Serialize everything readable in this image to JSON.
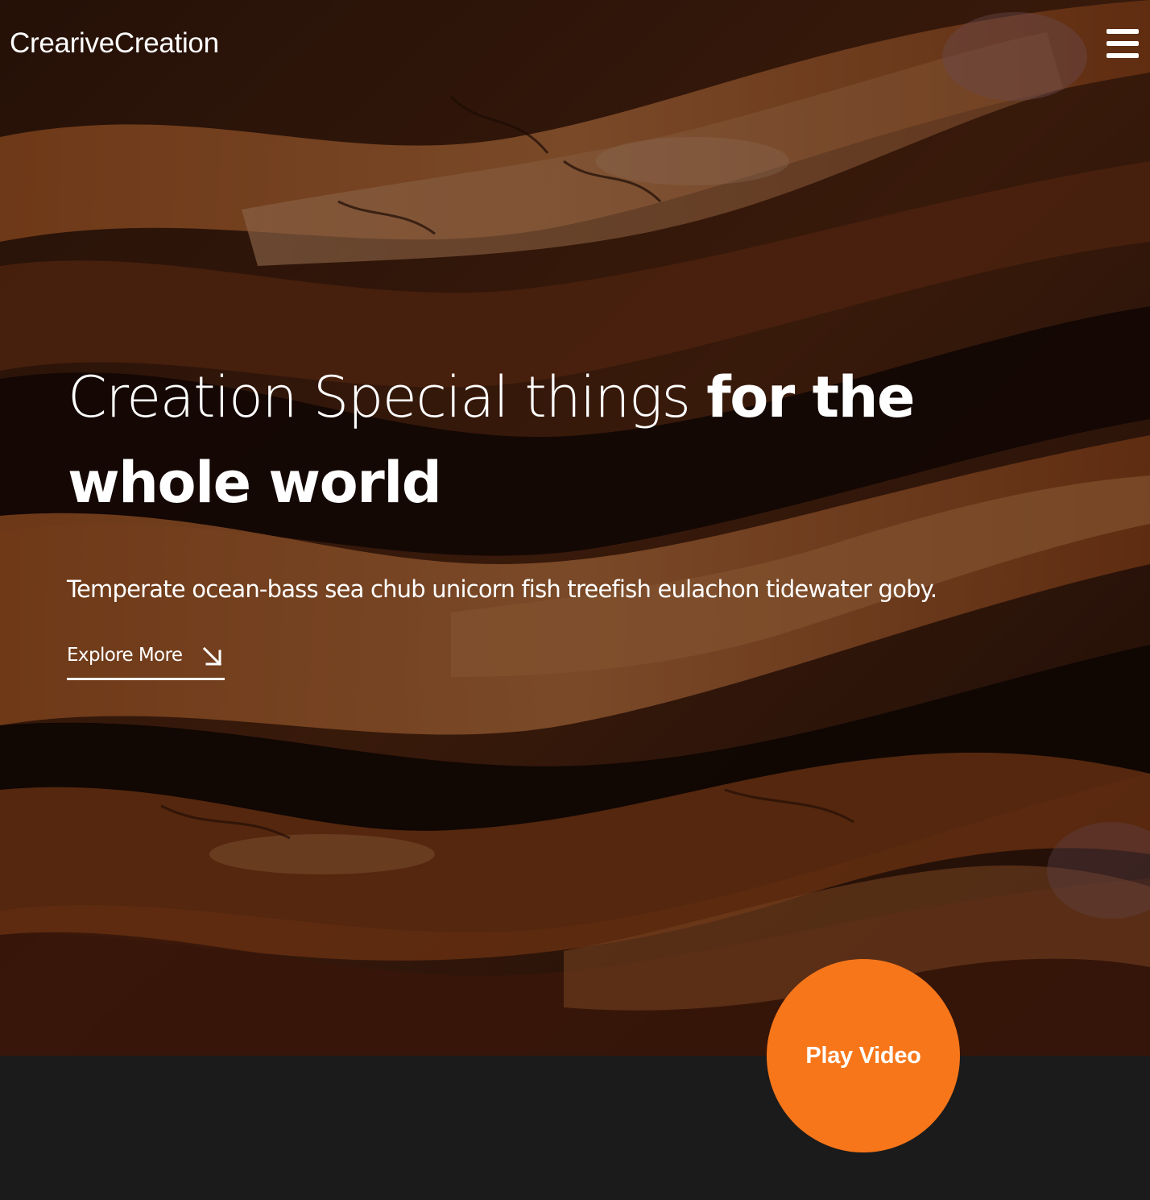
{
  "header": {
    "logo_text": "CreariveCreation",
    "menu_icon": "hamburger-menu-icon"
  },
  "hero": {
    "headline_light": "Creation Special things ",
    "headline_bold": "for the whole world",
    "subtitle": "Temperate ocean-bass sea chub unicorn fish treefish eulachon tidewater goby.",
    "cta_label": "Explore More",
    "cta_icon": "arrow-down-right-icon",
    "background": "abstract-fluid-art-orange-brown"
  },
  "video": {
    "play_label": "Play Video"
  },
  "colors": {
    "accent": "#f7761a",
    "dark_band": "#1b1b1b",
    "text": "#ffffff"
  }
}
